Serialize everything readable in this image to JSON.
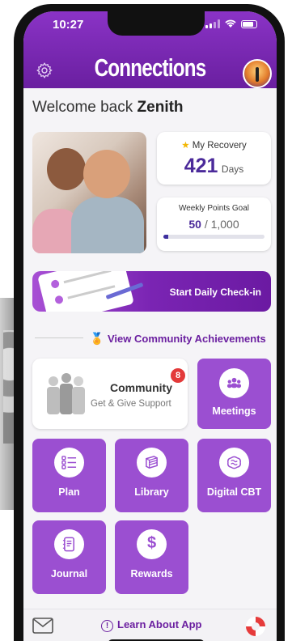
{
  "status_bar": {
    "time": "10:27"
  },
  "header": {
    "title": "Connections"
  },
  "welcome": {
    "prefix": "Welcome back",
    "name": "Zenith"
  },
  "recovery": {
    "label": "My Recovery",
    "value": "421",
    "unit": "Days"
  },
  "goal": {
    "label": "Weekly Points Goal",
    "current": "50",
    "target": "/ 1,000",
    "progress_fraction": 0.05
  },
  "checkin": {
    "label": "Start Daily Check-in"
  },
  "achievements": {
    "label": "View Community Achievements"
  },
  "community": {
    "title": "Community",
    "subtitle": "Get & Give Support",
    "badge": "8"
  },
  "tiles": {
    "meetings": "Meetings",
    "plan": "Plan",
    "library": "Library",
    "digital_cbt": "Digital CBT",
    "journal": "Journal",
    "rewards": "Rewards"
  },
  "footer": {
    "learn": "Learn About App"
  },
  "colors": {
    "brand": "#7a24b3",
    "tile": "#9b4fd1",
    "accent": "#4b2a9a",
    "badge": "#e33a3a"
  }
}
